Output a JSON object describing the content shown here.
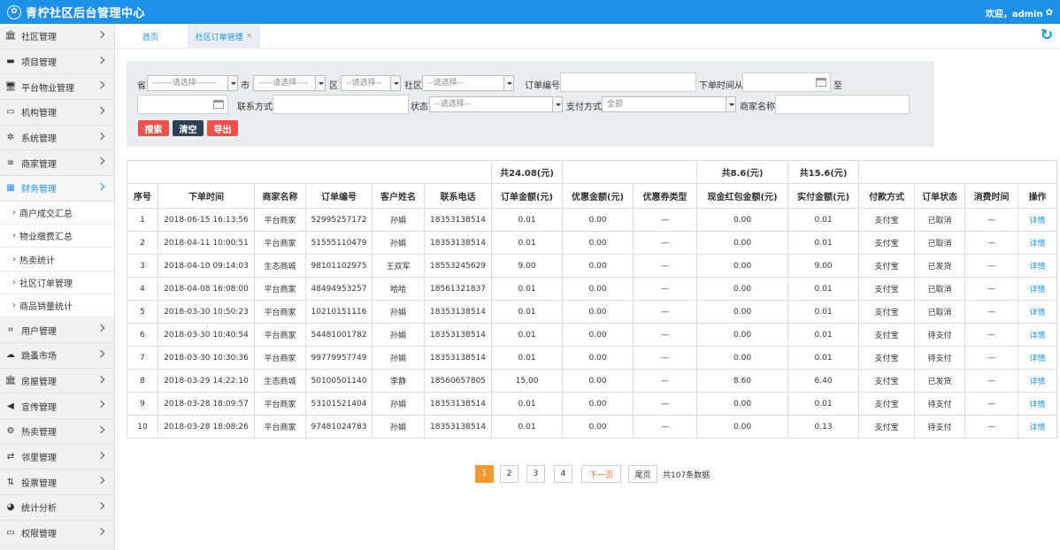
{
  "app": {
    "title": "青柠社区后台管理中心",
    "logo_glyph": "✿",
    "welcome": "欢迎，admin",
    "settings_glyph": "✿"
  },
  "colors": {
    "brand": "#1e90e6",
    "search": "#e8524a",
    "clear": "#2f4155",
    "export": "#e8524a",
    "page_active": "#f39a33"
  },
  "sidebar": {
    "items": [
      {
        "label": "社区管理",
        "icon": "bank-icon",
        "glyph": "🏛"
      },
      {
        "label": "项目管理",
        "icon": "project-icon",
        "glyph": "▬"
      },
      {
        "label": "平台物业管理",
        "icon": "monitor-icon",
        "glyph": "🖥"
      },
      {
        "label": "机构管理",
        "icon": "stripe-icon",
        "glyph": "▭"
      },
      {
        "label": "系统管理",
        "icon": "cogs-icon",
        "glyph": "✲"
      },
      {
        "label": "商家管理",
        "icon": "list-icon",
        "glyph": "≡"
      },
      {
        "label": "财务管理",
        "icon": "calculator-icon",
        "glyph": "▦"
      }
    ],
    "submenu": [
      "商户成交汇总",
      "物业缴费汇总",
      "热卖统计",
      "社区订单管理",
      "商品销量统计"
    ],
    "items_after": [
      {
        "label": "用户管理",
        "icon": "crop-icon",
        "glyph": "⌗"
      },
      {
        "label": "跳蚤市场",
        "icon": "cloud-icon",
        "glyph": "☁"
      },
      {
        "label": "房屋管理",
        "icon": "bank-icon",
        "glyph": "🏛"
      },
      {
        "label": "宣传管理",
        "icon": "volume-icon",
        "glyph": "◀"
      },
      {
        "label": "热卖管理",
        "icon": "gear-icon",
        "glyph": "⚙"
      },
      {
        "label": "邻里管理",
        "icon": "retweet-icon",
        "glyph": "⇄"
      },
      {
        "label": "投票管理",
        "icon": "sort-icon",
        "glyph": "⇅"
      },
      {
        "label": "统计分析",
        "icon": "pie-chart-icon",
        "glyph": "◕"
      },
      {
        "label": "权限管理",
        "icon": "desktop-icon",
        "glyph": "▭"
      }
    ]
  },
  "tabs": {
    "home": "首页",
    "active": "社区订单管理",
    "close": "×"
  },
  "refresh_glyph": "↻",
  "filter": {
    "province_label": "省",
    "province_value": "-------请选择-------",
    "city_label": "市",
    "city_value": "-----请选择----",
    "district_label": "区",
    "district_value": "--请选择--",
    "community_label": "社区",
    "community_value": "--请选择--",
    "order_no_label": "订单编号",
    "order_no_value": "",
    "time_from_label": "下单时间从",
    "time_from_value": "",
    "to_label": "至",
    "time_to_value": "",
    "contact_label": "联系方式",
    "contact_value": "",
    "status_label": "状态",
    "status_value": "--请选择--",
    "pay_label": "支付方式",
    "pay_value": "全部",
    "merchant_label": "商家名称",
    "merchant_value": "",
    "search_btn": "搜索",
    "clear_btn": "清空",
    "export_btn": "导出"
  },
  "table": {
    "sums": {
      "order_amount": "共24.08(元)",
      "cash_red": "共8.6(元)",
      "paid": "共15.6(元)"
    },
    "headers": [
      "序号",
      "下单时间",
      "商家名称",
      "订单编号",
      "客户姓名",
      "联系电话",
      "订单金额(元)",
      "优惠金额(元)",
      "优惠券类型",
      "现金红包金额(元)",
      "实付金额(元)",
      "付款方式",
      "订单状态",
      "消费时间",
      "操作"
    ],
    "rows": [
      [
        "1",
        "2018-06-15 16:13:56",
        "平台商家",
        "52995257172",
        "孙娟",
        "18353138514",
        "0.01",
        "0.00",
        "—",
        "0.00",
        "0.01",
        "支付宝",
        "已取消",
        "—",
        "详情"
      ],
      [
        "2",
        "2018-04-11 10:00:51",
        "平台商家",
        "51555110479",
        "孙娟",
        "18353138514",
        "0.01",
        "0.00",
        "—",
        "0.00",
        "0.01",
        "支付宝",
        "已取消",
        "—",
        "详情"
      ],
      [
        "3",
        "2018-04-10 09:14:03",
        "生态商城",
        "98101102975",
        "王双军",
        "18553245629",
        "9.00",
        "0.00",
        "—",
        "0.00",
        "9.00",
        "支付宝",
        "已发货",
        "—",
        "详情"
      ],
      [
        "4",
        "2018-04-08 16:08:00",
        "平台商家",
        "48494953257",
        "哈哈",
        "18561321837",
        "0.01",
        "0.00",
        "—",
        "0.00",
        "0.01",
        "支付宝",
        "已取消",
        "—",
        "详情"
      ],
      [
        "5",
        "2018-03-30 10:50:23",
        "平台商家",
        "10210151116",
        "孙娟",
        "18353138514",
        "0.01",
        "0.00",
        "—",
        "0.00",
        "0.01",
        "支付宝",
        "已取消",
        "—",
        "详情"
      ],
      [
        "6",
        "2018-03-30 10:40:54",
        "平台商家",
        "54481001782",
        "孙娟",
        "18353138514",
        "0.01",
        "0.00",
        "—",
        "0.00",
        "0.01",
        "支付宝",
        "待支付",
        "—",
        "详情"
      ],
      [
        "7",
        "2018-03-30 10:30:36",
        "平台商家",
        "99779957749",
        "孙娟",
        "18353138514",
        "0.01",
        "0.00",
        "—",
        "0.00",
        "0.01",
        "支付宝",
        "待支付",
        "—",
        "详情"
      ],
      [
        "8",
        "2018-03-29 14:22:10",
        "生态商城",
        "50100501140",
        "李静",
        "18560657805",
        "15.00",
        "0.00",
        "—",
        "8.60",
        "6.40",
        "支付宝",
        "已发货",
        "—",
        "详情"
      ],
      [
        "9",
        "2018-03-28 18:09:57",
        "平台商家",
        "53101521404",
        "孙娟",
        "18353138514",
        "0.01",
        "0.00",
        "—",
        "0.00",
        "0.01",
        "支付宝",
        "待支付",
        "—",
        "详情"
      ],
      [
        "10",
        "2018-03-28 18:08:26",
        "平台商家",
        "97481024783",
        "孙娟",
        "18353138514",
        "0.01",
        "0.00",
        "—",
        "0.00",
        "0.13",
        "支付宝",
        "待支付",
        "—",
        "详情"
      ]
    ]
  },
  "pagination": {
    "pages": [
      "1",
      "2",
      "3",
      "4"
    ],
    "current": "1",
    "next": "下一页",
    "last": "尾页",
    "total": "共107条数据"
  }
}
